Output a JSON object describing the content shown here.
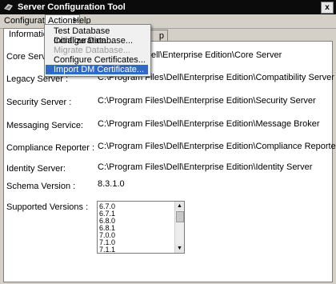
{
  "window": {
    "title": "Server Configuration Tool",
    "close_glyph": "x"
  },
  "menubar": {
    "items": [
      "Configuration",
      "Actions",
      "Help"
    ]
  },
  "actions_menu": {
    "items": [
      {
        "label": "Test Database Configuration...",
        "state": "enabled"
      },
      {
        "label": "Initialize Database...",
        "state": "enabled"
      },
      {
        "label": "Migrate Database...",
        "state": "disabled"
      },
      {
        "label": "Configure Certificates...",
        "state": "enabled"
      },
      {
        "label": "Import DM Certificate...",
        "state": "highlighted"
      }
    ]
  },
  "tabs": {
    "information": "Information",
    "partial_tab_text": "p"
  },
  "info": {
    "core_server_label": "Core Server :",
    "core_server_value": "ell\\Enterprise Edition\\Core Server",
    "legacy_server_label": "Legacy Server :",
    "legacy_server_value": "C:\\Program Files\\Dell\\Enterprise Edition\\Compatibility Server",
    "security_server_label": "Security Server :",
    "security_server_value": "C:\\Program Files\\Dell\\Enterprise Edition\\Security Server",
    "messaging_label": "Messaging Service:",
    "messaging_value": "C:\\Program Files\\Dell\\Enterprise Edition\\Message Broker",
    "compliance_label": "Compliance Reporter :",
    "compliance_value": "C:\\Program Files\\Dell\\Enterprise Edition\\Compliance Reporter",
    "identity_label": "Identity Server:",
    "identity_value": "C:\\Program Files\\Dell\\Enterprise Edition\\Identity Server",
    "schema_label": "Schema Version :",
    "schema_value": "8.3.1.0",
    "supported_label": "Supported Versions :",
    "supported_versions": [
      "6.7.0",
      "6.7.1",
      "6.8.0",
      "6.8.1",
      "7.0.0",
      "7.1.0",
      "7.1.1"
    ]
  },
  "icons": {
    "app": "app-icon",
    "scroll_up": "scroll-up-icon",
    "scroll_down": "scroll-down-icon"
  },
  "colors": {
    "title_bar": "#0b0b0b",
    "menu_highlight": "#316ac5",
    "window_bg": "#d4d0c8"
  }
}
